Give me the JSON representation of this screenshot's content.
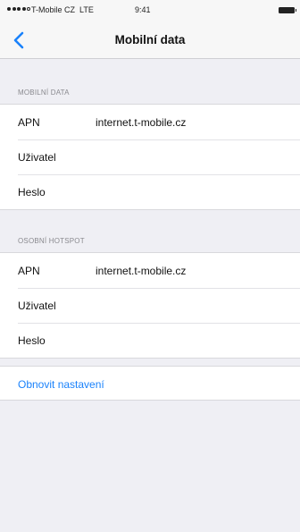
{
  "status_bar": {
    "carrier": "T-Mobile CZ",
    "network": "LTE",
    "time": "9:41"
  },
  "nav": {
    "title": "Mobilní data",
    "back_icon": "chevron-left-icon"
  },
  "sections": [
    {
      "header": "MOBILNÍ DATA",
      "rows": [
        {
          "label": "APN",
          "value": "internet.t-mobile.cz"
        },
        {
          "label": "Uživatel",
          "value": ""
        },
        {
          "label": "Heslo",
          "value": ""
        }
      ]
    },
    {
      "header": "OSOBNÍ HOTSPOT",
      "rows": [
        {
          "label": "APN",
          "value": "internet.t-mobile.cz"
        },
        {
          "label": "Uživatel",
          "value": ""
        },
        {
          "label": "Heslo",
          "value": ""
        }
      ]
    }
  ],
  "reset": {
    "label": "Obnovit nastavení"
  },
  "colors": {
    "accent": "#1a82fb",
    "background": "#efeff4"
  }
}
